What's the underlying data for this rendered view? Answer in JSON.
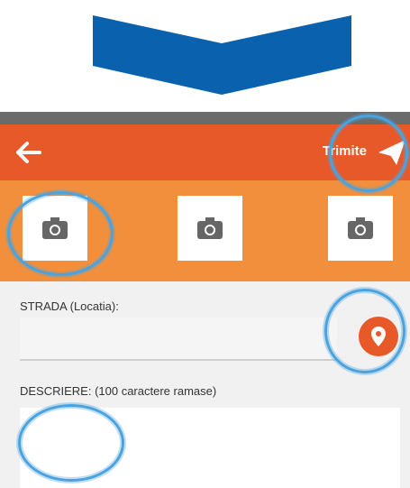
{
  "toolbar": {
    "send_label": "Trimite"
  },
  "form": {
    "street_label": "STRADA (Locatia):",
    "description_label": "DESCRIERE: (100 caractere ramase)"
  },
  "icons": [
    "down-arrow-icon",
    "back-arrow-icon",
    "send-icon",
    "camera-icon",
    "location-pin-icon",
    "annotation-circle"
  ],
  "colors": {
    "arrow": "#0a61ad",
    "toolbar": "#e8592a",
    "photo_strip": "#f18f3d",
    "annotation": "#4aa3df"
  }
}
